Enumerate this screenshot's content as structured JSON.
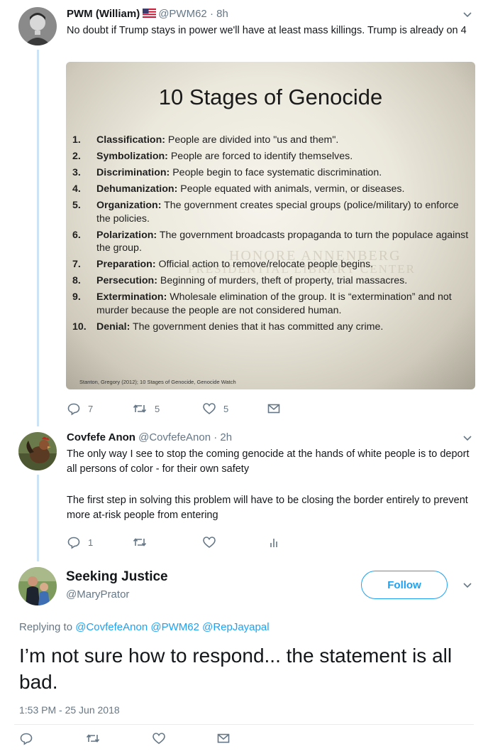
{
  "tweets": [
    {
      "name": "PWM (William)",
      "handle": "@PWM62",
      "time": "8h",
      "text": "No doubt if Trump stays in power we'll have at least mass killings. Trump is already on 4",
      "reply_count": "7",
      "retweet_count": "5",
      "like_count": "5",
      "icons": [
        "reply-icon",
        "retweet-icon",
        "like-icon",
        "dm-icon"
      ]
    },
    {
      "name": "Covfefe Anon",
      "handle": "@CovfefeAnon",
      "time": "2h",
      "text1": "The only way I see to stop the coming genocide at the hands of white people is to deport all persons of color - for their own safety",
      "text2": "The first step in solving this problem will have to be closing the border entirely to prevent more at-risk people from entering",
      "reply_count": "1",
      "icons": [
        "reply-icon",
        "retweet-icon",
        "like-icon",
        "analytics-icon"
      ]
    }
  ],
  "slide": {
    "title": "10 Stages of Genocide",
    "items": [
      {
        "num": "1.",
        "term": "Classification:",
        "desc": " People are divided into \"us and them\"."
      },
      {
        "num": "2.",
        "term": "Symbolization:",
        "desc": " People are forced to identify themselves."
      },
      {
        "num": "3.",
        "term": "Discrimination:",
        "desc": " People begin to face systematic discrimination."
      },
      {
        "num": "4.",
        "term": "Dehumanization:",
        "desc": " People equated with animals, vermin, or diseases."
      },
      {
        "num": "5.",
        "term": "Organization:",
        "desc": " The government creates special groups (police/military) to enforce the policies."
      },
      {
        "num": "6.",
        "term": "Polarization:",
        "desc": " The government broadcasts propaganda to turn the populace against the group."
      },
      {
        "num": "7.",
        "term": "Preparation:",
        "desc": " Official action to remove/relocate people begins."
      },
      {
        "num": "8.",
        "term": "Persecution:",
        "desc": " Beginning of murders, theft of property, trial massacres."
      },
      {
        "num": "9.",
        "term": "Extermination:",
        "desc": " Wholesale elimination of the group.  It is “extermination” and not murder because the people are not considered human."
      },
      {
        "num": "10.",
        "term": "Denial:",
        "desc": " The government denies that it has committed any crime."
      }
    ],
    "watermark_line1": "HONORE ANNENBERG",
    "watermark_line2": "PRESIDENTIAL LIBRARY CENTER",
    "citation": "Stanton, Gregory (2012); 10 Stages of Genocide, Genocide Watch"
  },
  "main_tweet": {
    "name": "Seeking Justice",
    "handle": "@MaryPrator",
    "follow_label": "Follow",
    "replying_prefix": "Replying to ",
    "replying_to": [
      "@CovfefeAnon",
      "@PWM62",
      "@RepJayapal"
    ],
    "text": "I’m not sure how to respond... the statement is all bad.",
    "timestamp": "1:53 PM - 25 Jun 2018",
    "icons": [
      "reply-icon",
      "retweet-icon",
      "like-icon",
      "dm-icon"
    ]
  },
  "colors": {
    "accent": "#1da1f2",
    "secondary_text": "#657786",
    "thread_line": "#cce3f5"
  }
}
